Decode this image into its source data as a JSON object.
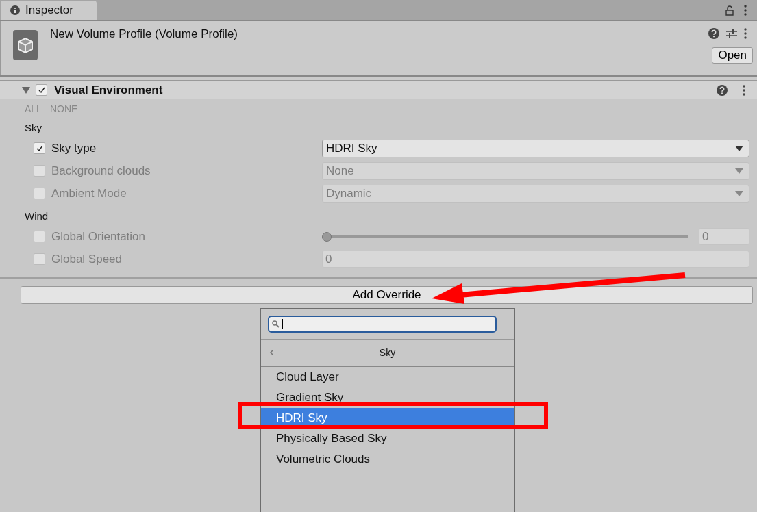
{
  "tab": {
    "label": "Inspector"
  },
  "header": {
    "title": "New Volume Profile (Volume Profile)",
    "open_button": "Open"
  },
  "component": {
    "title": "Visual Environment",
    "enabled": true,
    "expanded": true,
    "toggles": [
      "ALL",
      "NONE"
    ],
    "groups": [
      {
        "label": "Sky",
        "properties": [
          {
            "kind": "dropdown",
            "label": "Sky type",
            "overridden": true,
            "value": "HDRI Sky"
          },
          {
            "kind": "dropdown",
            "label": "Background clouds",
            "overridden": false,
            "value": "None"
          },
          {
            "kind": "dropdown",
            "label": "Ambient Mode",
            "overridden": false,
            "value": "Dynamic"
          }
        ]
      },
      {
        "label": "Wind",
        "properties": [
          {
            "kind": "slider",
            "label": "Global Orientation",
            "overridden": false,
            "level": 0,
            "value": "0"
          },
          {
            "kind": "number",
            "label": "Global Speed",
            "overridden": false,
            "value": "0"
          }
        ]
      }
    ]
  },
  "add_override_button": "Add Override",
  "popup": {
    "title": "Sky",
    "items": [
      {
        "label": "Cloud Layer",
        "selected": false
      },
      {
        "label": "Gradient Sky",
        "selected": false
      },
      {
        "label": "HDRI Sky",
        "selected": true
      },
      {
        "label": "Physically Based Sky",
        "selected": false
      },
      {
        "label": "Volumetric Clouds",
        "selected": false
      }
    ]
  }
}
